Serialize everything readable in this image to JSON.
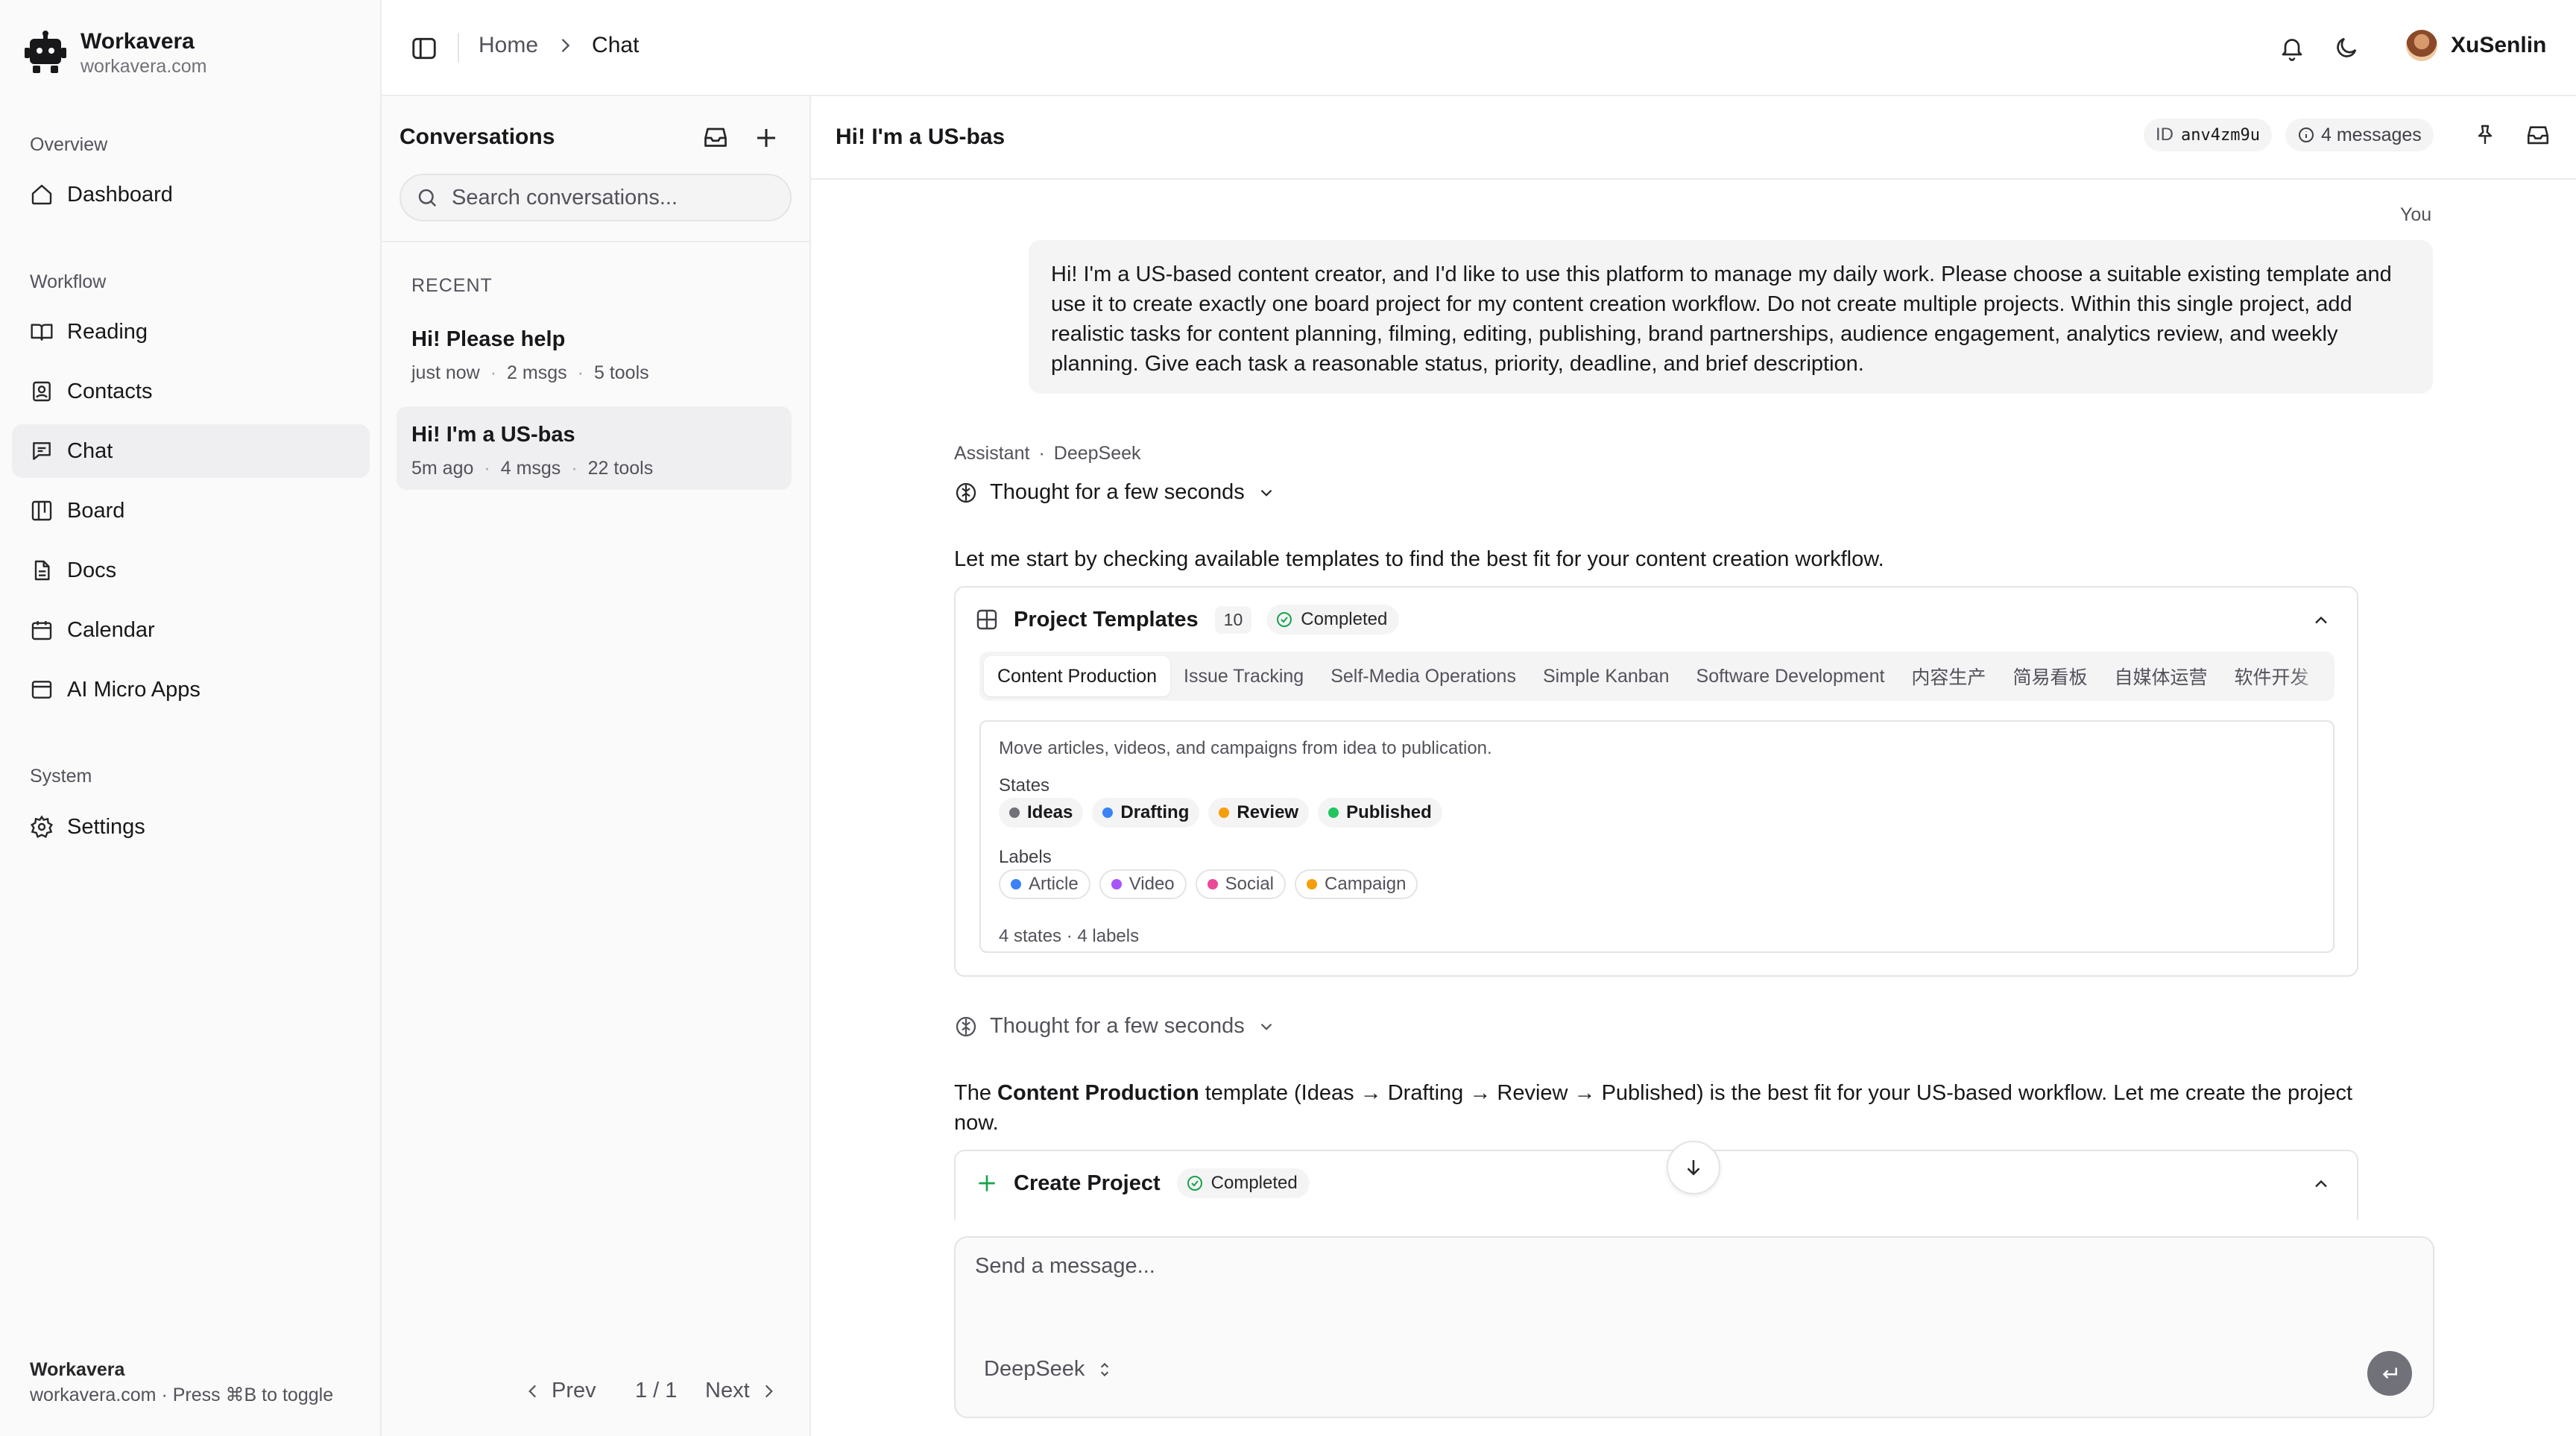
{
  "brand": {
    "name": "Workavera",
    "domain": "workavera.com"
  },
  "sidebar": {
    "sections": {
      "overview": "Overview",
      "workflow": "Workflow",
      "system": "System"
    },
    "items": [
      {
        "label": "Dashboard",
        "icon": "home-icon"
      },
      {
        "label": "Reading",
        "icon": "book-icon"
      },
      {
        "label": "Contacts",
        "icon": "contacts-icon"
      },
      {
        "label": "Chat",
        "icon": "chat-icon",
        "active": true
      },
      {
        "label": "Board",
        "icon": "board-icon"
      },
      {
        "label": "Docs",
        "icon": "docs-icon"
      },
      {
        "label": "Calendar",
        "icon": "calendar-icon"
      },
      {
        "label": "AI Micro Apps",
        "icon": "apps-icon"
      },
      {
        "label": "Settings",
        "icon": "gear-icon"
      }
    ],
    "footer": {
      "title": "Workavera",
      "hint": "workavera.com · Press ⌘B to toggle"
    }
  },
  "header": {
    "breadcrumb": {
      "home": "Home",
      "current": "Chat"
    },
    "user": {
      "name": "XuSenlin"
    }
  },
  "conversations": {
    "title": "Conversations",
    "search_placeholder": "Search conversations...",
    "section": "RECENT",
    "items": [
      {
        "title": "Hi! Please help",
        "time": "just now",
        "msgs": "2 msgs",
        "tools": "5 tools"
      },
      {
        "title": "Hi! I'm a US-bas",
        "time": "5m ago",
        "msgs": "4 msgs",
        "tools": "22 tools",
        "active": true
      }
    ],
    "pager": {
      "prev": "Prev",
      "page": "1 / 1",
      "next": "Next"
    }
  },
  "chat": {
    "title": "Hi! I'm a US-bas",
    "id_label": "ID",
    "id_value": "anv4zm9u",
    "messages_count": "4 messages",
    "you_label": "You",
    "user_message": "Hi! I'm a US-based content creator, and I'd like to use this platform to manage my daily work. Please choose a suitable existing template and use it to create exactly one board project for my content creation workflow. Do not create multiple projects. Within this single project, add realistic tasks for content planning, filming, editing, publishing, brand partnerships, audience engagement, analytics review, and weekly planning. Give each task a reasonable status, priority, deadline, and brief description.",
    "assistant_label": "Assistant",
    "model_label": "DeepSeek",
    "thought1": "Thought for a few seconds",
    "para1": "Let me start by checking available templates to find the best fit for your content creation workflow.",
    "tool1": {
      "name": "Project Templates",
      "count": "10",
      "status": "Completed",
      "tabs": [
        "Content Production",
        "Issue Tracking",
        "Self-Media Operations",
        "Simple Kanban",
        "Software Development",
        "内容生产",
        "简易看板",
        "自媒体运营",
        "软件开发"
      ],
      "description": "Move articles, videos, and campaigns from idea to publication.",
      "states_label": "States",
      "states": [
        {
          "name": "Ideas",
          "color": "#71717a"
        },
        {
          "name": "Drafting",
          "color": "#3b82f6"
        },
        {
          "name": "Review",
          "color": "#f59e0b"
        },
        {
          "name": "Published",
          "color": "#22c55e"
        }
      ],
      "labels_label": "Labels",
      "labels": [
        {
          "name": "Article",
          "color": "#3b82f6"
        },
        {
          "name": "Video",
          "color": "#a855f7"
        },
        {
          "name": "Social",
          "color": "#ec4899"
        },
        {
          "name": "Campaign",
          "color": "#f59e0b"
        }
      ],
      "summary": "4 states · 4 labels"
    },
    "thought2": "Thought for a few seconds",
    "para2": {
      "prefix": "The ",
      "bold": "Content Production",
      "suffix": " template (Ideas → Drafting → Review → Published) is the best fit for your US-based workflow. Let me create the project now."
    },
    "tool2": {
      "name": "Create Project",
      "status": "Completed"
    },
    "composer": {
      "placeholder": "Send a message...",
      "model": "DeepSeek"
    }
  }
}
